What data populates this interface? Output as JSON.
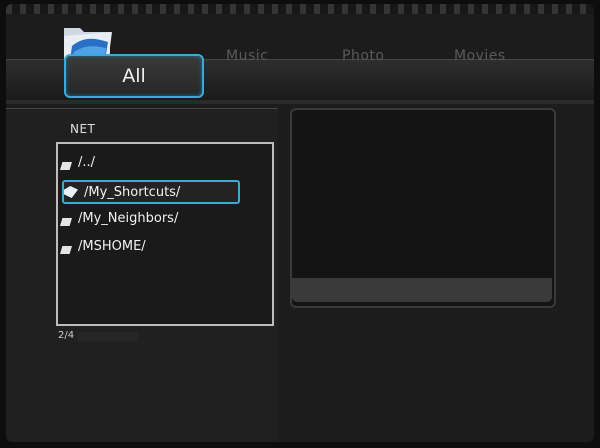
{
  "tabs": [
    {
      "label": "All",
      "active": true
    },
    {
      "label": "Music",
      "active": false
    },
    {
      "label": "Photo",
      "active": false
    },
    {
      "label": "Movies",
      "active": false
    }
  ],
  "browser": {
    "location": "NET",
    "items": [
      {
        "label": "/../",
        "selected": false,
        "icon": "folder-icon"
      },
      {
        "label": "/My_Shortcuts/",
        "selected": true,
        "icon": "folder-open-icon"
      },
      {
        "label": "/My_Neighbors/",
        "selected": false,
        "icon": "folder-icon"
      },
      {
        "label": "/MSHOME/",
        "selected": false,
        "icon": "folder-icon"
      }
    ],
    "page_count": "2/4"
  },
  "colors": {
    "accent": "#3ea8d8",
    "background": "#1c1c1c",
    "text": "#f2f2f2"
  }
}
